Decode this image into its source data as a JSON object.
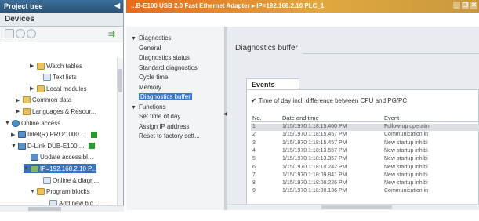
{
  "left_panel": {
    "title": "Project tree",
    "collapse_glyph": "◀",
    "tab": "Devices",
    "tree": [
      {
        "label": "Watch tables",
        "icon": "folder-icon",
        "indent": 38,
        "arrow": "▶"
      },
      {
        "label": "Text lists",
        "icon": "document-icon",
        "indent": 46,
        "arrow": ""
      },
      {
        "label": "Local modules",
        "icon": "folder-icon",
        "indent": 38,
        "arrow": "▶"
      },
      {
        "label": "Common data",
        "icon": "folder-icon",
        "indent": 20,
        "arrow": "▶"
      },
      {
        "label": "Languages & Resour...",
        "icon": "folder-icon",
        "indent": 20,
        "arrow": "▶"
      },
      {
        "label": "Online access",
        "icon": "globe-icon",
        "indent": 6,
        "arrow": "▼"
      },
      {
        "label": "Intel(R) PRO/1000 ...",
        "icon": "network-card-icon",
        "indent": 14,
        "arrow": "▶",
        "status": true
      },
      {
        "label": "D-Link DUB-E100 ...",
        "icon": "network-card-icon",
        "indent": 14,
        "arrow": "▼",
        "status": true
      },
      {
        "label": "Update accessibl...",
        "icon": "update-icon",
        "indent": 30,
        "arrow": ""
      },
      {
        "label": "IP=192.168.2.10 P...",
        "icon": "plc-icon",
        "indent": 30,
        "arrow": "▼",
        "selected": true
      },
      {
        "label": "Online & diagn...",
        "icon": "diagnostics-icon",
        "indent": 46,
        "arrow": ""
      },
      {
        "label": "Program blocks",
        "icon": "folder-icon",
        "indent": 38,
        "arrow": "▼"
      },
      {
        "label": "Add new blo...",
        "icon": "add-block-icon",
        "indent": 54,
        "arrow": ""
      }
    ]
  },
  "title_bar": {
    "text": "...B-E100 USB 2.0 Fast Ethernet Adapter  ▸  IP=192.168.2.10 PLC_1",
    "controls": [
      "_",
      "❐",
      "✕"
    ]
  },
  "nav": {
    "groups": [
      {
        "label": "Diagnostics",
        "arrow": "▼",
        "items": [
          "General",
          "Diagnostics status",
          "Standard diagnostics",
          "Cycle time",
          "Memory",
          "Diagnostics buffer"
        ],
        "selected": "Diagnostics buffer"
      },
      {
        "label": "Functions",
        "arrow": "▼",
        "items": [
          "Set time of day",
          "Assign IP address",
          "Reset to factory sett..."
        ]
      }
    ]
  },
  "content": {
    "heading": "Diagnostics buffer",
    "events_tab": "Events",
    "checkbox_label": "Time of day incl. difference between CPU and PG/PC",
    "columns": [
      "No.",
      "Date and time",
      "Event"
    ],
    "rows": [
      {
        "no": "1",
        "dt": "1/15/1970 1:18:15.460 PM",
        "ev": "Follow-up operatin",
        "selected": true
      },
      {
        "no": "2",
        "dt": "1/15/1970 1:18:15.457 PM",
        "ev": "Communication in"
      },
      {
        "no": "3",
        "dt": "1/15/1970 1:18:15.457 PM",
        "ev": "New startup inhibi"
      },
      {
        "no": "4",
        "dt": "1/15/1970 1:18:13.557 PM",
        "ev": "New startup inhibi"
      },
      {
        "no": "5",
        "dt": "1/15/1970 1:18:13.357 PM",
        "ev": "New startup inhibi"
      },
      {
        "no": "6",
        "dt": "1/15/1970 1:18:10.242 PM",
        "ev": "New startup inhibi"
      },
      {
        "no": "7",
        "dt": "1/15/1970 1:18:09.841 PM",
        "ev": "New startup inhibi"
      },
      {
        "no": "8",
        "dt": "1/15/1970 1:18:00.226 PM",
        "ev": "New startup inhibi"
      },
      {
        "no": "9",
        "dt": "1/15/1970 1:18:00.136 PM",
        "ev": "Communication in"
      }
    ]
  }
}
